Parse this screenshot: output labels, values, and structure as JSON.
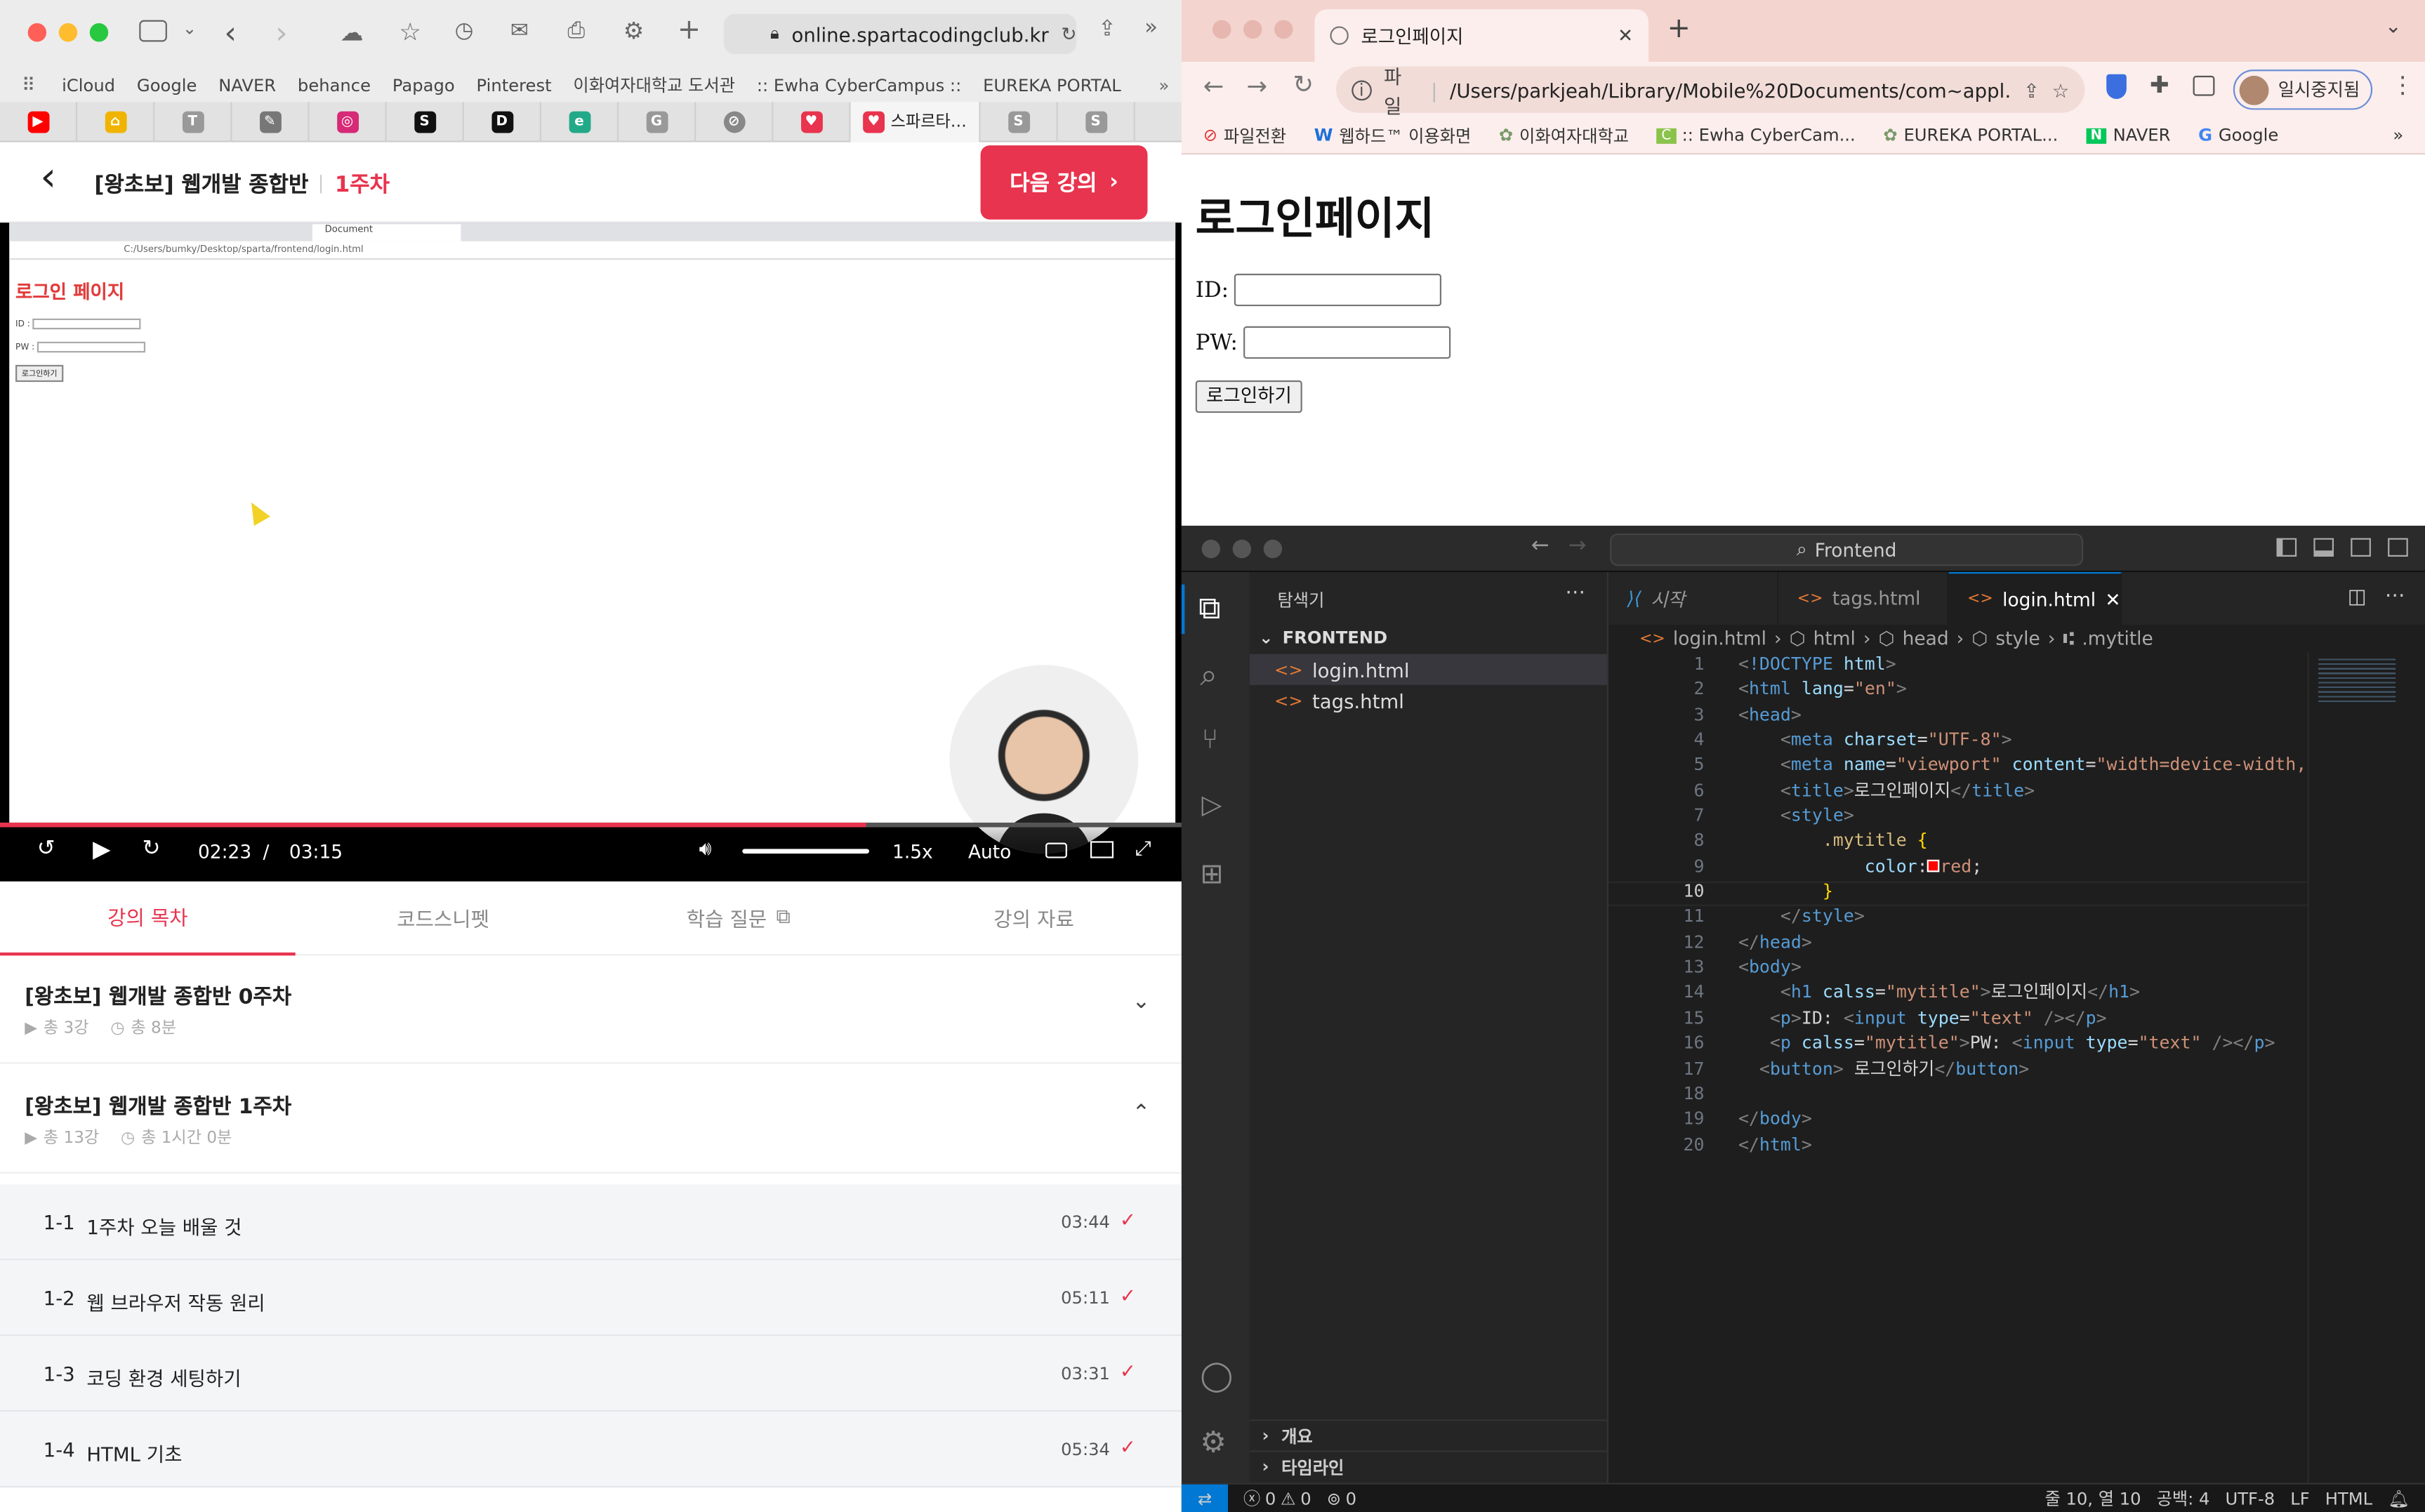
{
  "safari": {
    "url": "online.spartacodingclub.kr",
    "favorites": [
      "iCloud",
      "Google",
      "NAVER",
      "behance",
      "Papago",
      "Pinterest",
      "이화여자대학교 도서관",
      ":: Ewha CyberCampus ::",
      "EUREKA PORTAL"
    ],
    "active_tab_title": "스파르타…"
  },
  "course": {
    "title": "[왕초보] 웹개발 종합반",
    "week": "1주차",
    "next_button": "다음 강의"
  },
  "video": {
    "inner_title": "로그인 페이지",
    "inner_id_label": "ID :",
    "inner_pw_label": "PW :",
    "inner_button": "로그인하기",
    "inner_url": "C:/Users/bumky/Desktop/sparta/frontend/login.html",
    "inner_tab": "Document",
    "current_time": "02:23",
    "separator": "/",
    "duration": "03:15",
    "speed": "1.5x",
    "quality": "Auto",
    "progress": 0.733
  },
  "course_tabs": [
    {
      "label": "강의 목차",
      "active": true
    },
    {
      "label": "코드스니펫"
    },
    {
      "label": "학습 질문"
    },
    {
      "label": "강의 자료"
    }
  ],
  "sections": [
    {
      "title": "[왕초보] 웹개발 종합반 0주차",
      "lectures": "총 3강",
      "time": "총 8분"
    },
    {
      "title": "[왕초보] 웹개발 종합반 1주차",
      "lectures": "총 13강",
      "time": "총 1시간 0분"
    }
  ],
  "lessons": [
    {
      "num": "1-1",
      "title": "1주차 오늘 배울 것",
      "time": "03:44"
    },
    {
      "num": "1-2",
      "title": "웹 브라우저 작동 원리",
      "time": "05:11"
    },
    {
      "num": "1-3",
      "title": "코딩 환경 세팅하기",
      "time": "03:31"
    },
    {
      "num": "1-4",
      "title": "HTML 기초",
      "time": "05:34"
    }
  ],
  "chrome": {
    "tab_title": "로그인페이지",
    "address_prefix": "파일",
    "address": "/Users/parkjeah/Library/Mobile%20Documents/com~appl…",
    "profile": "일시중지됨",
    "bookmarks": [
      "파일전환",
      "웹하드™ 이용화면",
      "이화여자대학교",
      ":: Ewha CyberCam...",
      "EUREKA PORTAL...",
      "NAVER",
      "Google"
    ]
  },
  "page": {
    "heading": "로그인페이지",
    "id_label": "ID:",
    "pw_label": "PW:",
    "button": "로그인하기"
  },
  "vscode": {
    "search": "Frontend",
    "explorer": "탐색기",
    "folder": "FRONTEND",
    "files": [
      "login.html",
      "tags.html"
    ],
    "tabs": [
      "시작",
      "tags.html",
      "login.html"
    ],
    "breadcrumb": [
      "login.html",
      "html",
      "head",
      "style",
      ".mytitle"
    ],
    "outline": "개요",
    "timeline": "타임라인",
    "status": {
      "errors": "0",
      "warnings": "0",
      "ports": "0",
      "position": "줄 10, 열 10",
      "spaces": "공백: 4",
      "encoding": "UTF-8",
      "eol": "LF",
      "lang": "HTML"
    }
  }
}
